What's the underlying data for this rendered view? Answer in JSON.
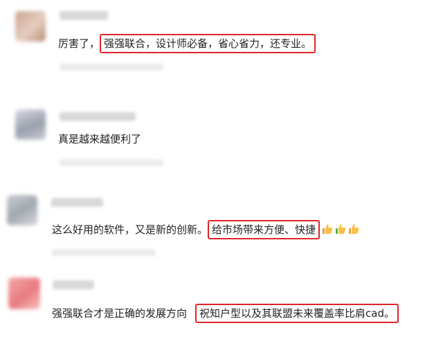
{
  "comments": [
    {
      "text_before": "厉害了，",
      "highlight": "强强联合，设计师必备，省心省力，还专业。",
      "text_after": ""
    },
    {
      "text_before": "真是越来越便利了",
      "highlight": "",
      "text_after": ""
    },
    {
      "text_before": "这么好用的软件，又是新的创新。",
      "highlight": "给市场带来方便、快捷",
      "emoji": [
        "thumbs-up-icon",
        "thumbs-up-icon",
        "thumbs-up-icon"
      ]
    },
    {
      "text_before": "强强联合才是正确的发展方向",
      "highlight": "祝知户型以及其联盟未来覆盖率比肩cad。",
      "text_after": ""
    }
  ],
  "colors": {
    "highlight_border": "#e0232a",
    "text": "#222222"
  }
}
